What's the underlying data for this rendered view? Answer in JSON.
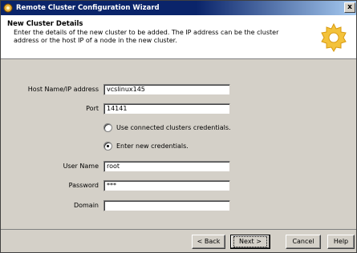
{
  "window": {
    "title": "Remote Cluster Configuration Wizard",
    "close_symbol": "x"
  },
  "header": {
    "title": "New Cluster Details",
    "description": "Enter the details of the new cluster to be added. The IP address can be the cluster address or the host IP of a node in the new cluster."
  },
  "form": {
    "host": {
      "label": "Host Name/IP address",
      "value": "vcslinux145"
    },
    "port": {
      "label": "Port",
      "value": "14141"
    },
    "credentials": {
      "use_connected": {
        "label": "Use connected clusters credentials.",
        "checked": false
      },
      "enter_new": {
        "label": "Enter new credentials.",
        "checked": true
      }
    },
    "username": {
      "label": "User Name",
      "value": "root"
    },
    "password": {
      "label": "Password",
      "value": "***"
    },
    "domain": {
      "label": "Domain",
      "value": ""
    }
  },
  "footer": {
    "back_label": "< Back",
    "next_label": "Next >",
    "cancel_label": "Cancel",
    "help_label": "Help"
  }
}
